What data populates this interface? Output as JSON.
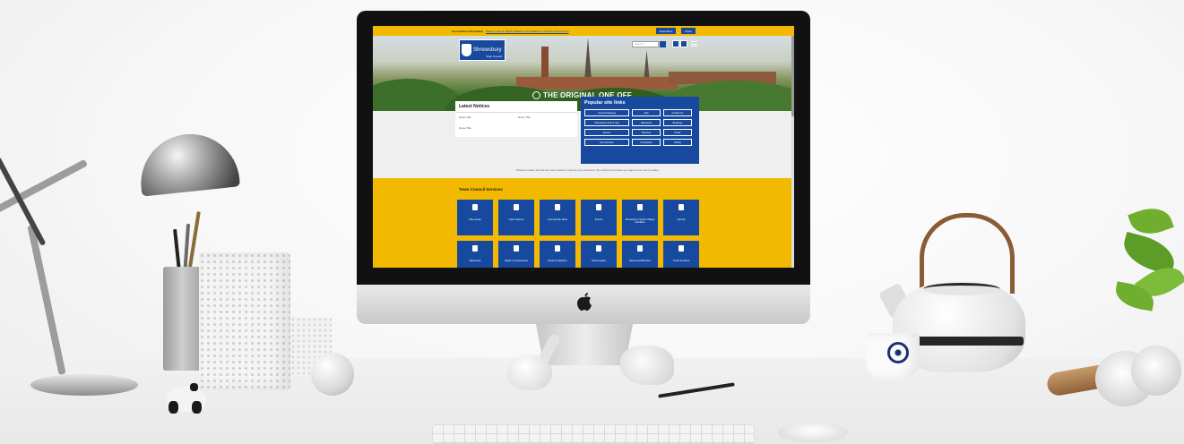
{
  "site": {
    "alert": {
      "title": "Coronavirus information",
      "text": "Please read our latest guidance and updates on council services here",
      "button_primary": "Read More",
      "button_secondary": "Close"
    },
    "logo": {
      "name": "Shrewsbury",
      "subtitle": "Town Council"
    },
    "search": {
      "placeholder": "Search"
    },
    "tagline": "THE ORIGINAL ONE OFF",
    "notices": {
      "title": "Latest Notices",
      "items": [
        "News Title",
        "News Title",
        "News Title"
      ]
    },
    "popular_links": {
      "title": "Popular site links",
      "items": [
        "Council Meetings",
        "Jobs",
        "Contact Us",
        "Shrewsbury Fruit & Veg",
        "Allotments",
        "Bookings",
        "Events",
        "Planning",
        "Parks",
        "Bus Services",
        "Cemeteries",
        "Charity"
      ]
    },
    "cookie_note": "Please be aware that this site uses cookies to improve your experience. By continuing to browse you agree to our use of cookies.",
    "services": {
      "title": "Town Council Services",
      "tiles": [
        "Play Areas",
        "Open Spaces",
        "Countryside Sites",
        "Events",
        "Shrewsbury Sports Village Facilities",
        "Venues",
        "Allotments",
        "Public Conveniences",
        "Parks & Gardens",
        "Street Lights",
        "Seats and Benches",
        "Youth Services"
      ]
    }
  },
  "colors": {
    "brand_blue": "#174a9e",
    "brand_yellow": "#f3b800"
  }
}
